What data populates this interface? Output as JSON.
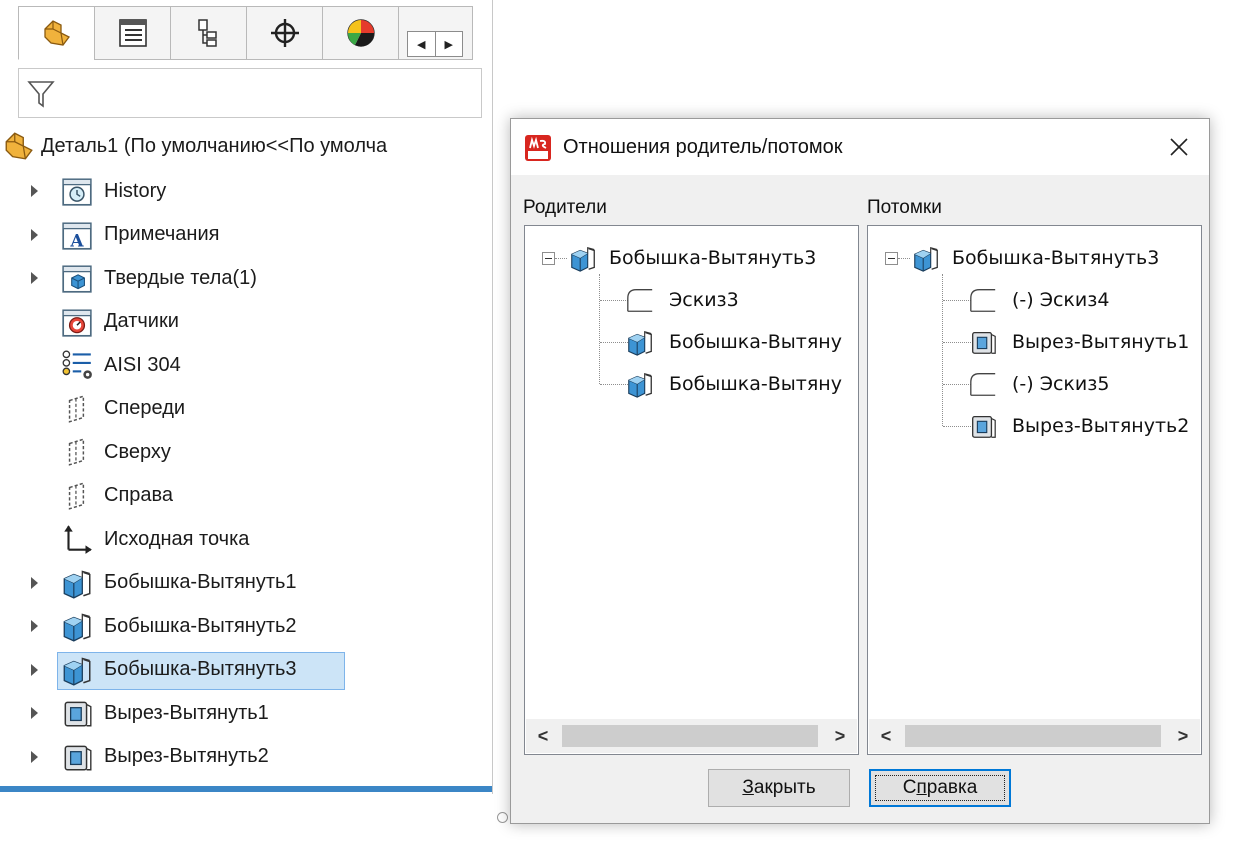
{
  "feature_manager": {
    "tabs": [
      {
        "name": "feature-manager",
        "icon": "part-icon"
      },
      {
        "name": "property-manager",
        "icon": "property-manager-icon"
      },
      {
        "name": "configuration-manager",
        "icon": "configuration-manager-icon"
      },
      {
        "name": "dimxpert-manager",
        "icon": "dimxpert-icon"
      },
      {
        "name": "display-manager",
        "icon": "appearance-icon"
      }
    ],
    "filter_icon": "filter-icon",
    "root": "Деталь1  (По умолчанию<<По умолча",
    "items": [
      {
        "label": "History",
        "icon": "history-folder-icon",
        "expandable": true
      },
      {
        "label": "Примечания",
        "icon": "annotations-icon",
        "expandable": true
      },
      {
        "label": "Твердые тела(1)",
        "icon": "solid-bodies-icon",
        "expandable": true
      },
      {
        "label": "Датчики",
        "icon": "sensors-icon",
        "expandable": false
      },
      {
        "label": "AISI 304",
        "icon": "material-icon",
        "expandable": false
      },
      {
        "label": "Спереди",
        "icon": "plane-icon",
        "expandable": false
      },
      {
        "label": "Сверху",
        "icon": "plane-icon",
        "expandable": false
      },
      {
        "label": "Справа",
        "icon": "plane-icon",
        "expandable": false
      },
      {
        "label": "Исходная точка",
        "icon": "origin-icon",
        "expandable": false
      },
      {
        "label": "Бобышка-Вытянуть1",
        "icon": "boss-extrude-icon",
        "expandable": true
      },
      {
        "label": "Бобышка-Вытянуть2",
        "icon": "boss-extrude-icon",
        "expandable": true
      },
      {
        "label": "Бобышка-Вытянуть3",
        "icon": "boss-extrude-icon",
        "expandable": true,
        "selected": true
      },
      {
        "label": "Вырез-Вытянуть1",
        "icon": "cut-extrude-icon",
        "expandable": true
      },
      {
        "label": "Вырез-Вытянуть2",
        "icon": "cut-extrude-icon",
        "expandable": true
      }
    ]
  },
  "dialog": {
    "title": "Отношения родитель/потомок",
    "close_icon": "close-icon",
    "parents": {
      "label": "Родители",
      "root": "Бобышка-Вытянуть3",
      "children": [
        {
          "label": "Эскиз3",
          "icon": "sketch-icon"
        },
        {
          "label": "Бобышка-Вытяну",
          "icon": "boss-extrude-icon"
        },
        {
          "label": "Бобышка-Вытяну",
          "icon": "boss-extrude-icon"
        }
      ]
    },
    "children": {
      "label": "Потомки",
      "root": "Бобышка-Вытянуть3",
      "children": [
        {
          "label": "(-) Эскиз4",
          "icon": "sketch-icon"
        },
        {
          "label": "Вырез-Вытянуть1",
          "icon": "cut-extrude-icon"
        },
        {
          "label": "(-) Эскиз5",
          "icon": "sketch-icon"
        },
        {
          "label": "Вырез-Вытянуть2",
          "icon": "cut-extrude-icon"
        }
      ]
    },
    "buttons": {
      "close_label": "Закрыть",
      "help_label": "Справка"
    }
  }
}
